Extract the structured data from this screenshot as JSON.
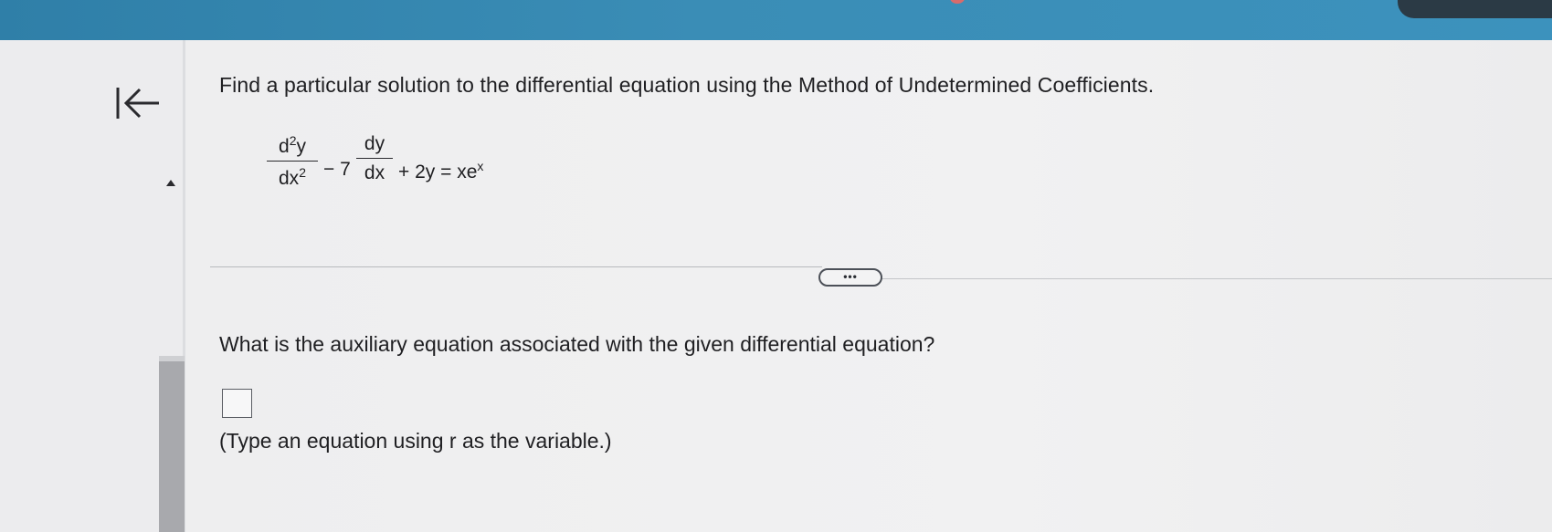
{
  "question": {
    "title": "Find a particular solution to the differential equation using the Method of Undetermined Coefficients."
  },
  "equation": {
    "term1_numerator": "d",
    "term1_numerator_sup": "2",
    "term1_numerator_var": "y",
    "term1_denominator": "dx",
    "term1_denominator_sup": "2",
    "minus_coeff": "− 7",
    "term2_numerator": "dy",
    "term2_denominator": "dx",
    "rest": "+ 2y = xe",
    "rest_sup": "x"
  },
  "toolbar": {
    "more_label": "•••"
  },
  "part": {
    "question": "What is the auxiliary equation associated with the given differential equation?",
    "answer_value": "",
    "hint": "(Type an equation using r as the variable.)"
  },
  "colors": {
    "top_bar": "#3a8db6",
    "background": "#eeeeef",
    "scroll_thumb": "#a8a9ad"
  },
  "icons": {
    "back": "back-to-start-icon",
    "scroll_up": "triangle-up-icon"
  }
}
